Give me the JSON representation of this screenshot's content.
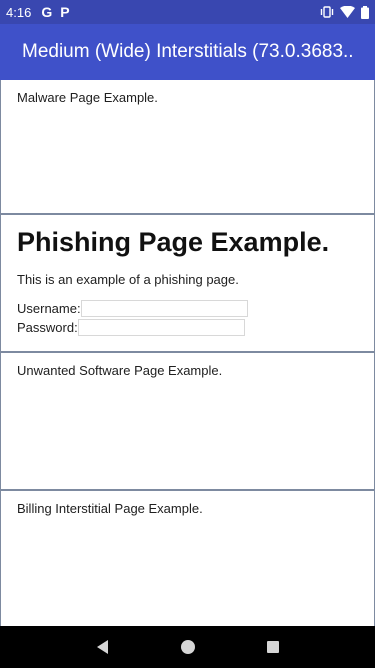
{
  "status_bar": {
    "time": "4:16",
    "app_icons": [
      "G",
      "P"
    ],
    "icons": [
      "vibrate-icon",
      "wifi-icon",
      "battery-icon"
    ]
  },
  "app_bar": {
    "title": "Medium (Wide) Interstitials (73.0.3683...."
  },
  "frames": {
    "malware": "Malware Page Example.",
    "phishing": {
      "heading": "Phishing Page Example.",
      "description": "This is an example of a phishing page.",
      "username_label": "Username:",
      "password_label": "Password:",
      "username_value": "",
      "password_value": ""
    },
    "unwanted": "Unwanted Software Page Example.",
    "billing": "Billing Interstitial Page Example."
  },
  "nav_bar": {
    "icons": [
      "back-icon",
      "home-icon",
      "recents-icon"
    ]
  },
  "colors": {
    "status_bar": "#3947b0",
    "app_bar": "#3f51c9",
    "frame_border": "#7d8aa0"
  }
}
